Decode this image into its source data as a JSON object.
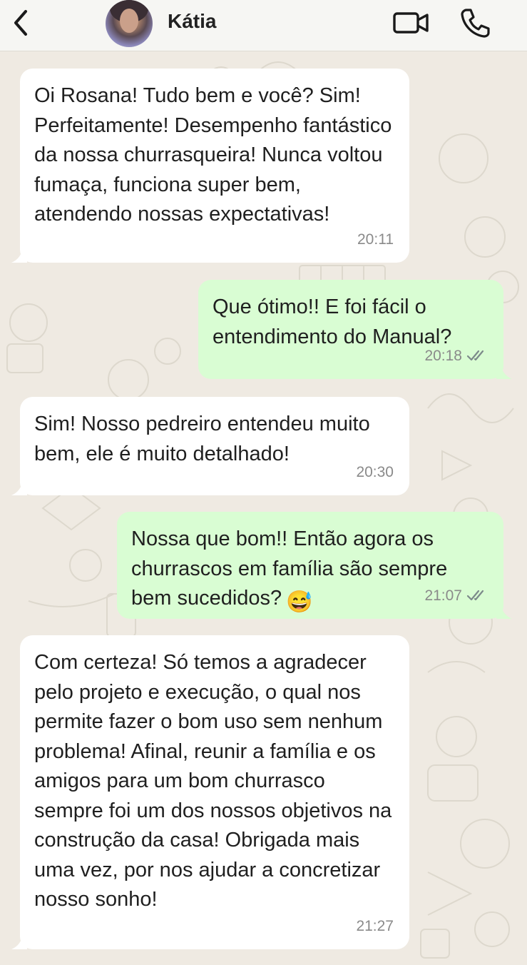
{
  "header": {
    "contact_name": "Kátia",
    "back_icon": "chevron-left-icon",
    "video_icon": "video-camera-icon",
    "call_icon": "phone-icon"
  },
  "colors": {
    "incoming_bubble": "#ffffff",
    "outgoing_bubble": "#d9fdd3",
    "chat_background": "#efeae2",
    "read_ticks": "#7c8a8a"
  },
  "messages": [
    {
      "direction": "incoming",
      "text": "Oi Rosana! Tudo bem e você? Sim! Perfeitamente! Desempenho fantástico da nossa churrasqueira! Nunca voltou fumaça, funciona super bem, atendendo nossas expectativas!",
      "time": "20:11"
    },
    {
      "direction": "outgoing",
      "text": "Que ótimo!! E foi fácil o entendimento do Manual?",
      "time": "20:18",
      "status": "read"
    },
    {
      "direction": "incoming",
      "text": "Sim! Nosso pedreiro entendeu muito bem, ele é muito detalhado!",
      "time": "20:30"
    },
    {
      "direction": "outgoing",
      "text": "Nossa que bom!! Então agora os churrascos em família são sempre bem sucedidos?",
      "emoji": "😅",
      "time": "21:07",
      "status": "read"
    },
    {
      "direction": "incoming",
      "text": "Com certeza! Só temos a agradecer pelo projeto e execução, o qual nos permite fazer o bom uso sem nenhum problema! Afinal, reunir a família e os amigos para um bom churrasco sempre foi um dos nossos objetivos na construção da casa! Obrigada mais uma vez, por nos ajudar a concretizar nosso sonho!",
      "time": "21:27"
    }
  ]
}
